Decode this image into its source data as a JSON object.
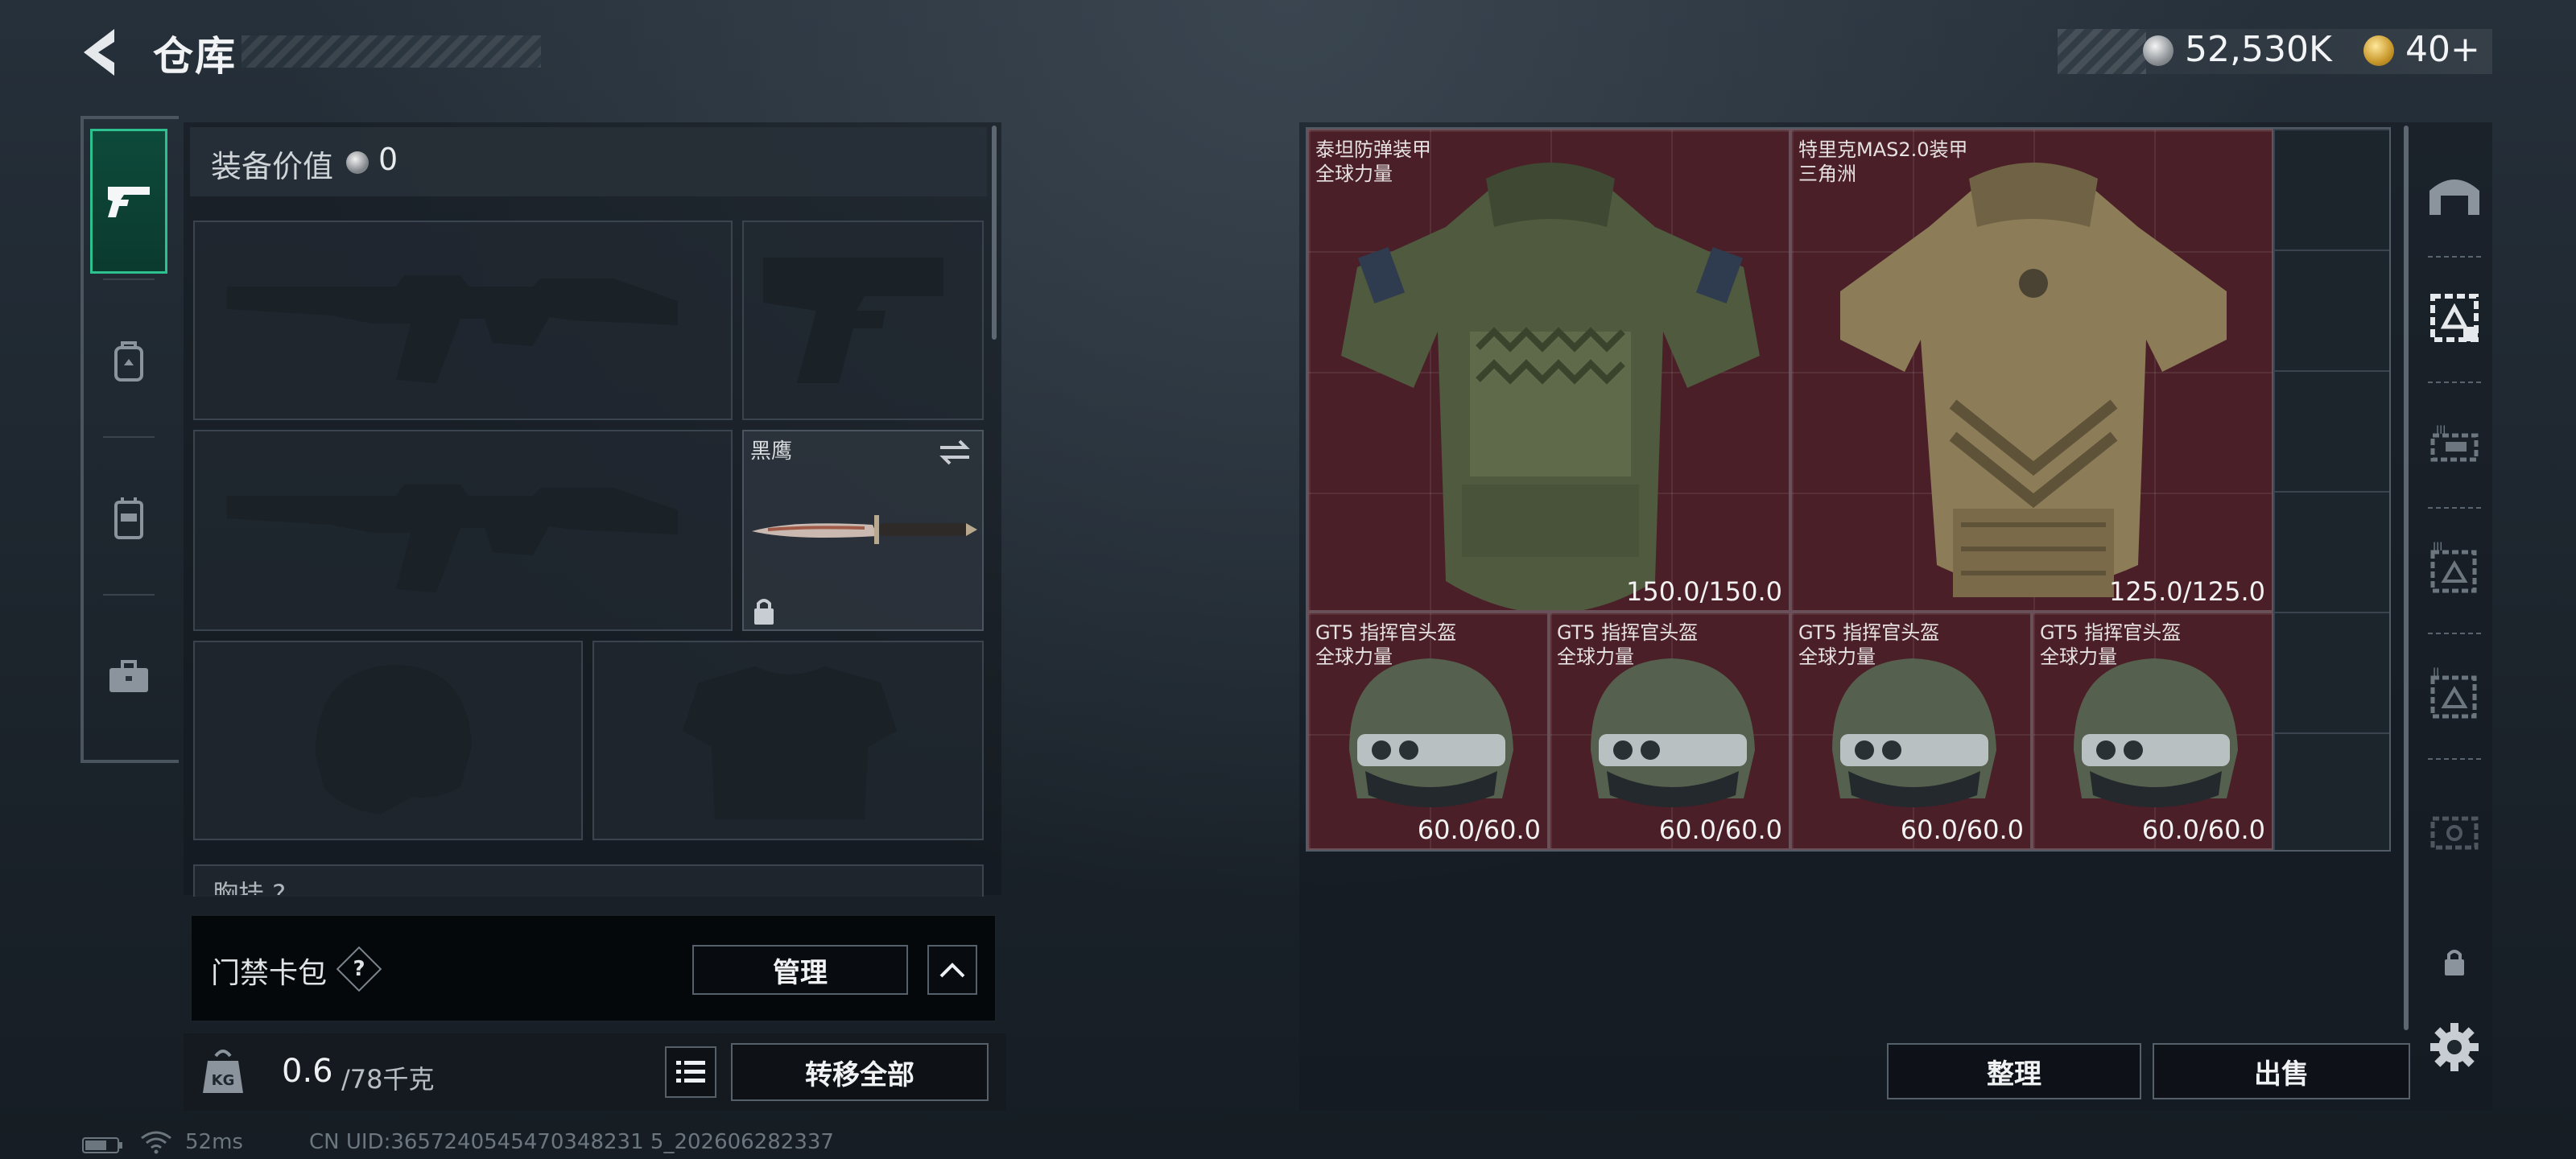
{
  "header": {
    "title": "仓库",
    "silver_value": "52,530K",
    "gold_value": "40+"
  },
  "categories": [
    "weapons",
    "backpack",
    "chest-rig",
    "case"
  ],
  "equipment": {
    "value_label": "装备价值",
    "value": "0",
    "melee_name": "黑鹰",
    "chest_label": "胸挂 ?"
  },
  "keycard": {
    "label": "门禁卡包",
    "help": "?",
    "manage_label": "管理"
  },
  "weight": {
    "current": "0.6",
    "max": "/78千克",
    "transfer_label": "转移全部"
  },
  "status": {
    "ping": "52ms",
    "uid": "CN UID:3657240545470348231 5_202606282337"
  },
  "storage": {
    "items": [
      {
        "name": "泰坦防弹装甲",
        "sub": "全球力量",
        "durability": "150.0/150.0"
      },
      {
        "name": "特里克MAS2.0装甲",
        "sub": "三角洲",
        "durability": "125.0/125.0"
      },
      {
        "name": "GT5 指挥官头盔",
        "sub": "全球力量",
        "durability": "60.0/60.0"
      },
      {
        "name": "GT5 指挥官头盔",
        "sub": "全球力量",
        "durability": "60.0/60.0"
      },
      {
        "name": "GT5 指挥官头盔",
        "sub": "全球力量",
        "durability": "60.0/60.0"
      },
      {
        "name": "GT5 指挥官头盔",
        "sub": "全球力量",
        "durability": "60.0/60.0"
      }
    ],
    "sort_label": "整理",
    "sell_label": "出售"
  },
  "colors": {
    "accent": "#2cc18e",
    "item_bg": "#4a1f27"
  }
}
